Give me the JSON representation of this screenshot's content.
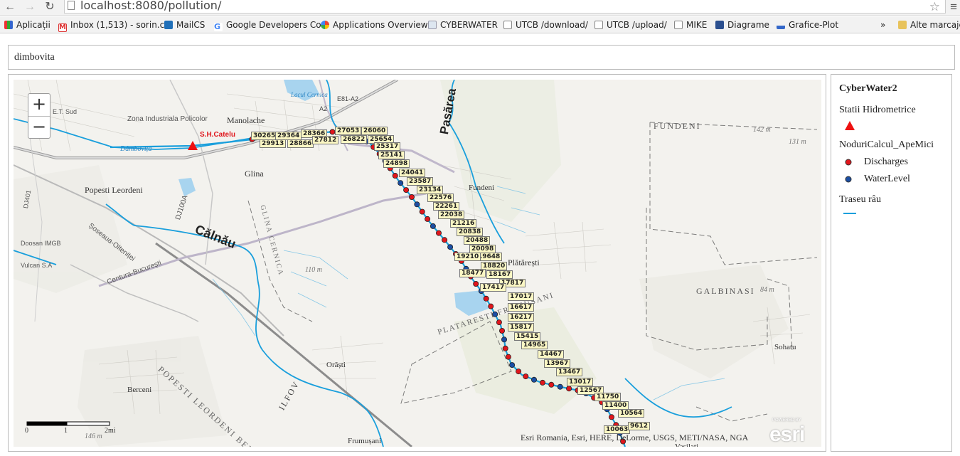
{
  "browser": {
    "url": "localhost:8080/pollution/",
    "bookmarks": [
      "Aplicații",
      "Inbox (1,513) - sorin.c",
      "MailCS",
      "Google Developers Co",
      "Applications Overview",
      "CYBERWATER",
      "UTCB /download/",
      "UTCB /upload/",
      "MIKE",
      "Diagrame",
      "Grafice-Plot",
      "»",
      "Alte marcaje"
    ]
  },
  "search": {
    "value": "dimbovita"
  },
  "map": {
    "zoom_in": "+",
    "zoom_out": "−",
    "station_label": "S.H.Catelu",
    "place_labels": [
      "Manolache",
      "Zona Industriala Policolor",
      "E.T. Sud",
      "Glina",
      "Popesti Leordeni",
      "Fundeni",
      "FUNDENI",
      "Pasărea",
      "Călnău",
      "GLINA CERNICA",
      "Plătărești",
      "PLATARESTI FRUMUSANI",
      "GALBINASI",
      "Sohatu",
      "Orăști",
      "Berceni",
      "POPESTI LEORDENI BERCENI",
      "ILFOV",
      "Frumușani",
      "Dâmbovița",
      "Șoseaua-Olteniței",
      "Centura-București",
      "DJ100A",
      "Lacul Cernica",
      "Doosan IMGB",
      "Vulcan S.A",
      "142 m",
      "131 m",
      "110 m",
      "84 m",
      "146 m",
      "Vasilati",
      "DJ401",
      "E81-A2",
      "A2"
    ],
    "node_labels": [
      "30265",
      "29913",
      "29364",
      "28866",
      "28366",
      "27812",
      "27053",
      "26822",
      "26060",
      "25654",
      "25317",
      "25141",
      "24898",
      "24041",
      "23587",
      "23134",
      "22576",
      "22261",
      "22038",
      "21216",
      "20838",
      "20488",
      "20098",
      "19648",
      "19210",
      "18820",
      "18477",
      "18167",
      "17817",
      "17417",
      "17017",
      "16617",
      "16217",
      "15817",
      "15415",
      "14965",
      "14467",
      "13967",
      "13467",
      "13017",
      "12567",
      "11750",
      "11400",
      "10564",
      "10063",
      "9612"
    ],
    "attribution": "Esri Romania, Esri, HERE, DeLorme, USGS, METI/NASA, NGA",
    "esri_logo": "esri",
    "esri_powered": "POWERED BY",
    "scale": {
      "zero": "0",
      "one": "1",
      "two": "2mi"
    }
  },
  "legend": {
    "title": "CyberWater2",
    "layers": [
      {
        "name": "Statii Hidrometrice",
        "items": []
      },
      {
        "name": "NoduriCalcul_ApeMici",
        "items": [
          "Discharges",
          "WaterLevel"
        ]
      },
      {
        "name": "Traseu râu",
        "items": []
      }
    ]
  },
  "colors": {
    "river": "#1a9fdc",
    "discharge": "#e0161c",
    "waterlevel": "#1b4ea3",
    "station": "#ee1111",
    "label_bg": "#fbf7c4"
  }
}
